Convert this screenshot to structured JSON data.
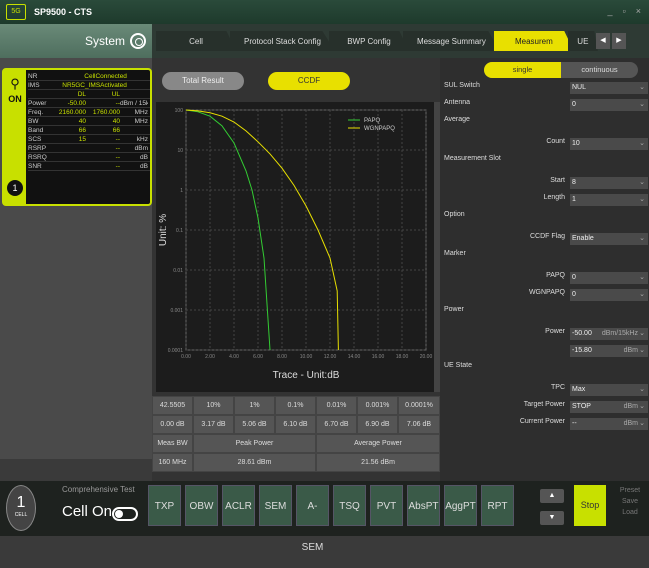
{
  "app": {
    "logo": "5G",
    "title": "SP9500 - CTS",
    "controls": [
      "_",
      "▫",
      "×"
    ]
  },
  "system": {
    "label": "System"
  },
  "cell": {
    "on_label": "ON",
    "number": "1",
    "rows": [
      [
        "NR",
        "",
        "CellConnected",
        ""
      ],
      [
        "IMS",
        "",
        "NR5GC_IMSActivated",
        ""
      ],
      [
        "",
        "DL",
        "UL",
        ""
      ],
      [
        "Power",
        "-50.00",
        "--",
        "dBm / 15kHz"
      ],
      [
        "Freq.",
        "2160.000",
        "1760.000",
        "MHz"
      ],
      [
        "BW",
        "40",
        "40",
        "MHz"
      ],
      [
        "Band",
        "66",
        "66",
        ""
      ],
      [
        "SCS",
        "15",
        "--",
        "kHz"
      ],
      [
        "RSRP",
        "",
        "--",
        "dBm"
      ],
      [
        "RSRQ",
        "",
        "--",
        "dB"
      ],
      [
        "SNR",
        "",
        "--",
        "dB"
      ]
    ]
  },
  "tabs": [
    "Cell",
    "Protocol Stack Config",
    "BWP Config",
    "Message Summary",
    "Measurem",
    "UE"
  ],
  "active_tab": 4,
  "buttons": {
    "total": "Total Result",
    "ccdf": "CCDF"
  },
  "chart_data": {
    "type": "line",
    "xlabel": "Trace - Unit:dB",
    "ylabel": "Unit: %",
    "y_log": true,
    "ylim": [
      0.0001,
      100
    ],
    "xlim": [
      0,
      20
    ],
    "x_ticks": [
      "0.00",
      "2.00",
      "4.00",
      "6.00",
      "8.00",
      "10.00",
      "12.00",
      "14.00",
      "16.00",
      "18.00",
      "20.00"
    ],
    "y_ticks": [
      "100",
      "10",
      "1",
      "0.1",
      "0.01",
      "0.001",
      "0.0001"
    ],
    "series": [
      {
        "name": "PAPQ",
        "color": "#33cc33",
        "x": [
          0,
          1,
          2,
          3,
          4,
          5,
          5.5,
          6,
          6.5,
          7
        ],
        "y": [
          100,
          90,
          70,
          40,
          15,
          3,
          1,
          0.2,
          0.02,
          0.0001
        ]
      },
      {
        "name": "WGNPAPQ",
        "color": "#e8e000",
        "x": [
          0,
          1,
          2,
          3,
          4,
          5,
          6,
          7,
          8,
          9,
          10,
          11,
          12,
          12.6,
          12.7
        ],
        "y": [
          100,
          95,
          85,
          70,
          50,
          30,
          16,
          8,
          3.5,
          1.3,
          0.4,
          0.1,
          0.02,
          0.003,
          0.0001
        ]
      }
    ]
  },
  "table": {
    "rows": [
      [
        "42.5505",
        "10%",
        "1%",
        "0.1%",
        "0.01%",
        "0.001%",
        "0.0001%"
      ],
      [
        "0.00 dB",
        "3.17 dB",
        "5.06 dB",
        "6.10 dB",
        "6.70 dB",
        "6.90 dB",
        "7.06 dB"
      ]
    ],
    "power_header": [
      "Meas BW",
      "Peak Power",
      "Average Power"
    ],
    "power_values": [
      "160 MHz",
      "28.61 dBm",
      "21.56 dBm"
    ]
  },
  "right": {
    "seg": [
      "single",
      "continuous"
    ],
    "params": [
      {
        "label": "SUL Switch",
        "value": "NUL",
        "section": true
      },
      {
        "label": "Antenna",
        "value": "0",
        "section": true
      },
      {
        "label": "Average",
        "value": "",
        "section": true
      },
      {
        "label": "Count",
        "value": "10",
        "section": false
      },
      {
        "label": "Measurement Slot",
        "value": "",
        "section": true
      },
      {
        "label": "Start",
        "value": "8",
        "section": false
      },
      {
        "label": "Length",
        "value": "1",
        "section": false
      },
      {
        "label": "Option",
        "value": "",
        "section": true
      },
      {
        "label": "CCDF Flag",
        "value": "Enable",
        "section": false
      },
      {
        "label": "Marker",
        "value": "",
        "section": true
      },
      {
        "label": "PAPQ",
        "value": "0",
        "section": false
      },
      {
        "label": "WGNPAPQ",
        "value": "0",
        "section": false
      },
      {
        "label": "Power",
        "value": "",
        "section": true
      },
      {
        "label": "Power",
        "value": "-50.00",
        "unit": "dBm/15kHz",
        "section": false
      },
      {
        "label": "",
        "value": "-15.80",
        "unit": "dBm",
        "section": false
      },
      {
        "label": "UE State",
        "value": "",
        "section": true
      },
      {
        "label": "TPC",
        "value": "Max",
        "section": false
      },
      {
        "label": "Target Power",
        "value": "STOP",
        "unit": "dBm",
        "section": false
      },
      {
        "label": "Current Power",
        "value": "--",
        "unit": "dBm",
        "section": false
      }
    ]
  },
  "bottom": {
    "cell_number": "1",
    "cell_text": "CELL",
    "comp_label": "Comprehensive Test",
    "cell_on": "Cell On",
    "meas_buttons": [
      "TXP",
      "OBW",
      "ACLR",
      "SEM",
      "A-SEM",
      "TSQ",
      "PVT",
      "AbsPT",
      "AggPT",
      "RPT"
    ],
    "stop": "Stop",
    "preset": [
      "Preset",
      "Save",
      "Load"
    ]
  }
}
